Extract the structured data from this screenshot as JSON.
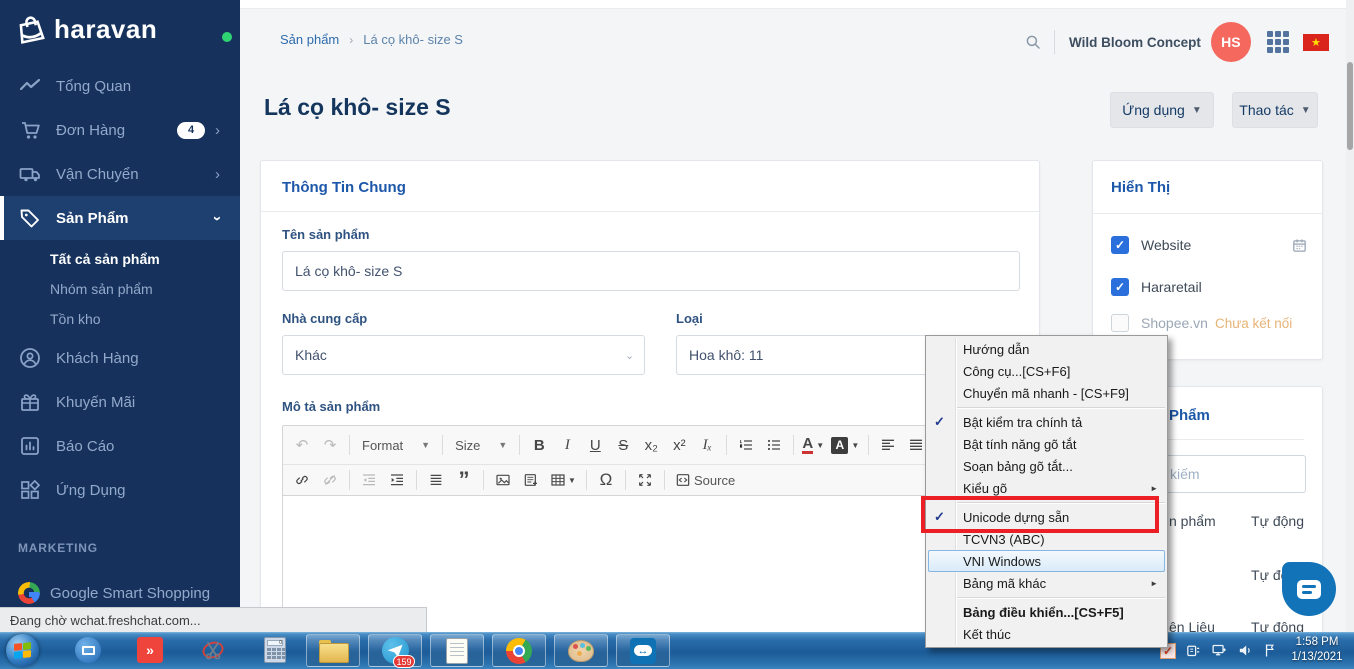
{
  "colors": {
    "sidebar_bg": "#16325C",
    "accent_blue": "#1C57A9",
    "checkbox_blue": "#2A6FDB",
    "annotation_red": "#EC2024",
    "avatar_coral": "#F4685E",
    "warning_orange": "#E7B377",
    "taskbar_blue": "#1C5C98",
    "flag_red": "#DA251D",
    "status_dot_green": "#2FD573"
  },
  "sidebar": {
    "logo_text": "haravan",
    "items": [
      {
        "label": "Tổng Quan",
        "icon": "i-chart"
      },
      {
        "label": "Đơn Hàng",
        "icon": "i-cart",
        "badge": "4",
        "chevron_right": true
      },
      {
        "label": "Vận Chuyển",
        "icon": "i-truck",
        "chevron_right": true
      },
      {
        "label": "Sản Phẩm",
        "icon": "i-tag",
        "active": true,
        "chevron_down": true
      }
    ],
    "submenu": [
      {
        "label": "Tất cả sản phẩm",
        "active": true
      },
      {
        "label": "Nhóm sản phẩm"
      },
      {
        "label": "Tồn kho"
      }
    ],
    "items2": [
      {
        "label": "Khách Hàng",
        "icon": "i-user"
      },
      {
        "label": "Khuyến Mãi",
        "icon": "i-gift"
      },
      {
        "label": "Báo Cáo",
        "icon": "i-report"
      },
      {
        "label": "Ứng Dụng",
        "icon": "i-apps"
      }
    ],
    "section_label": "MARKETING",
    "marketing_item": "Google Smart Shopping"
  },
  "header": {
    "breadcrumb_1": "Sản phẩm",
    "breadcrumb_sep": "›",
    "breadcrumb_2": "Lá cọ khô- size S",
    "store_name": "Wild Bloom Concept",
    "avatar_initials": "HS"
  },
  "page": {
    "title": "Lá cọ khô- size S",
    "apps_button": "Ứng dụng",
    "actions_button": "Thao tác"
  },
  "general_card": {
    "title": "Thông Tin Chung",
    "name_label": "Tên sản phẩm",
    "name_value": "Lá cọ khô- size S",
    "vendor_label": "Nhà cung cấp",
    "vendor_value": "Khác",
    "type_label": "Loại",
    "type_value": "Hoa khô: 11",
    "desc_label": "Mô tả sản phẩm"
  },
  "editor": {
    "format_label": "Format",
    "size_label": "Size",
    "source_label": "Source",
    "glyphs": {
      "bold": "B",
      "italic": "I",
      "underline": "U",
      "strike": "S",
      "sub": "x₂",
      "sup": "x²",
      "removefmt": "Iₓ",
      "omega": "Ω",
      "quote": "”",
      "undo": "↶",
      "redo": "↷",
      "color_a": "A",
      "bg_a": "A"
    }
  },
  "visibility_card": {
    "title": "Hiển Thị",
    "channels": [
      {
        "label": "Website",
        "checked": true,
        "has_schedule": true
      },
      {
        "label": "Hararetail",
        "checked": true
      },
      {
        "label": "Shopee.vn",
        "dim": true,
        "status": "Chưa kết nối"
      }
    ]
  },
  "organization_card": {
    "title_fragment": "Phẩm",
    "search_placeholder_fragment": "kiếm",
    "rows": [
      {
        "label_fragment": "n phẩm",
        "value": "Tự động"
      },
      {
        "label_fragment": "",
        "value": "Tự động"
      },
      {
        "label_fragment": "ên Liệu",
        "value": "Tự động"
      }
    ]
  },
  "context_menu": {
    "items": [
      {
        "label": "Hướng dẫn"
      },
      {
        "label": "Công cụ...[CS+F6]"
      },
      {
        "label": "Chuyển mã nhanh - [CS+F9]"
      },
      {
        "type": "separator"
      },
      {
        "label": "Bật kiểm tra chính tả",
        "checked": true
      },
      {
        "label": "Bật tính năng gõ tắt"
      },
      {
        "label": "Soạn bảng gõ tắt..."
      },
      {
        "label": "Kiểu gõ",
        "submenu": true
      },
      {
        "type": "separator"
      },
      {
        "label": "Unicode dựng sẵn",
        "checked": true
      },
      {
        "label": "TCVN3 (ABC)"
      },
      {
        "label": "VNI Windows",
        "hovered": true
      },
      {
        "label": "Bảng mã khác",
        "submenu": true
      },
      {
        "type": "separator"
      },
      {
        "label": "Bảng điều khiển...[CS+F5]",
        "bold": true
      },
      {
        "label": "Kết thúc"
      }
    ]
  },
  "status_bar": {
    "text": "Đang chờ wchat.freshchat.com..."
  },
  "taskbar": {
    "telegram_badge": "159",
    "clock_time": "1:58 PM",
    "clock_date": "1/13/2021"
  }
}
